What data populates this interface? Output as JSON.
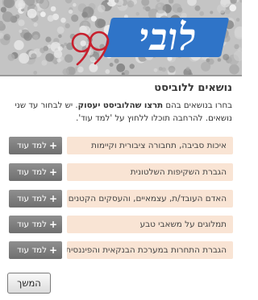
{
  "header": {
    "logo_text": "לובי",
    "logo_number": "99"
  },
  "headline": "נושאים ללוביסט",
  "intro": {
    "text_before": "בחרו בנושאים בהם ",
    "text_bold": "תרצו שהלוביסט יעסוק",
    "text_after": ". יש לבחור עד שני נושאים. להרחבה תוכלו ללחוץ על 'למד עוד'."
  },
  "topics": [
    {
      "label": "איכות סביבה, תחבורה ציבורית וקיימות",
      "more_label": "למד עוד"
    },
    {
      "label": "הגברת השקיפות השלטונית",
      "more_label": "למד עוד"
    },
    {
      "label": "האדם העובד/ת, עצמאיים, והעסקים הקטנים",
      "more_label": "למד עוד"
    },
    {
      "label": "תמלוגים על משאבי טבע",
      "more_label": "למד עוד"
    },
    {
      "label": "הגברת התחרות במערכת הבנקאית והפיננסית",
      "more_label": "למד עוד"
    }
  ],
  "continue_label": "המשך",
  "icons": {
    "plus": "plus-icon"
  },
  "colors": {
    "topic_background": "#f9e4d4",
    "button_gray": "#7e7e7e",
    "logo_blue": "#2f74c8",
    "logo_accent_red": "#c8202e"
  }
}
